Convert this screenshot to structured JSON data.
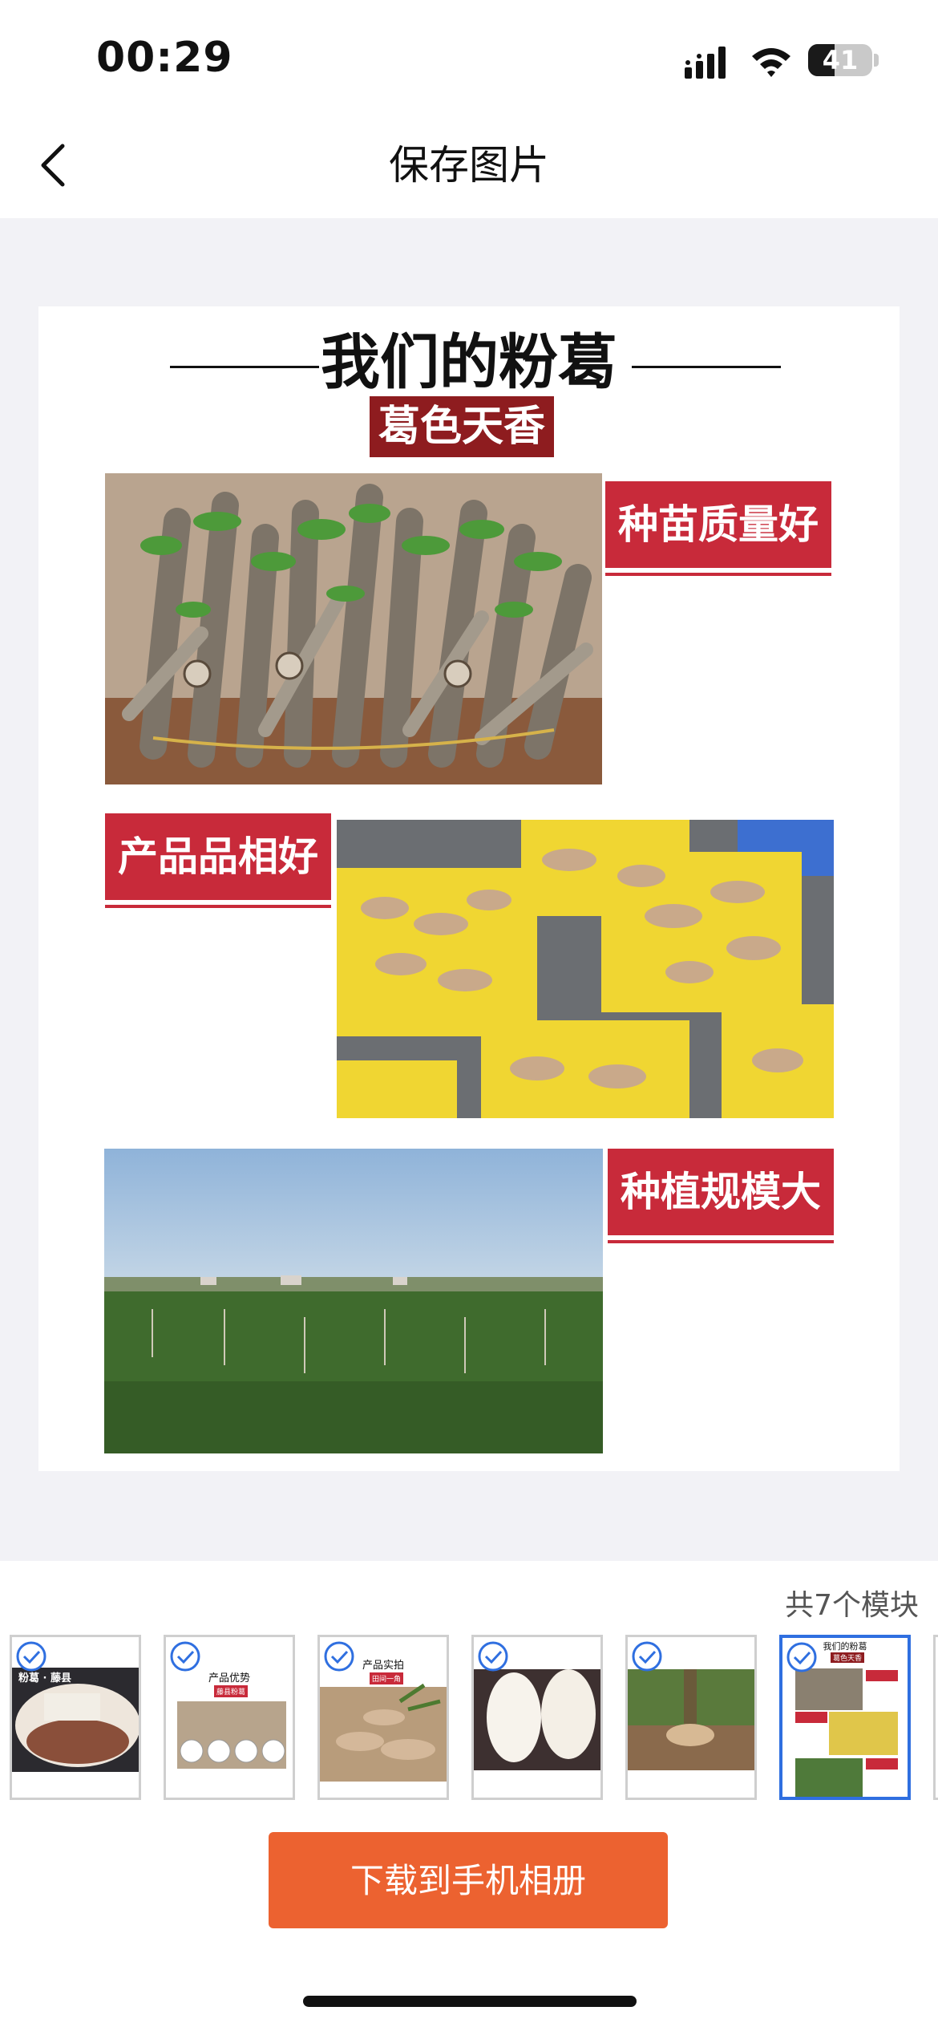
{
  "status_bar": {
    "time": "00:29",
    "battery": "41",
    "battery_level": 0.41
  },
  "nav": {
    "title": "保存图片",
    "back_icon": "chevron-left-icon"
  },
  "poster": {
    "heading": "我们的粉葛",
    "brand": "葛色天香",
    "labels": [
      "种苗质量好",
      "产品品相好",
      "种植规模大"
    ]
  },
  "modules": {
    "count_text": "共7个模块",
    "thumbnails": [
      {
        "title": "粉葛 · 藤县",
        "selected": false,
        "checked": true
      },
      {
        "title": "产品优势",
        "tag": "藤县粉葛",
        "selected": false,
        "checked": true
      },
      {
        "title": "产品实拍",
        "tag": "田间一角",
        "selected": false,
        "checked": true
      },
      {
        "selected": false,
        "checked": true
      },
      {
        "selected": false,
        "checked": true
      },
      {
        "title": "我们的粉葛",
        "tag": "葛色天香",
        "selected": true,
        "checked": true
      }
    ]
  },
  "download_button": "下载到手机相册",
  "colors": {
    "accent": "#ec6230",
    "label_red": "#c82a3a",
    "brand_red": "#8e1c1f",
    "select_blue": "#2f6fe0",
    "preview_bg": "#f2f2f6"
  }
}
